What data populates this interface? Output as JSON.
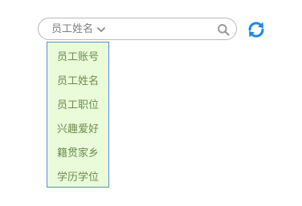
{
  "search": {
    "field_label": "员工姓名",
    "input_value": "",
    "placeholder": "",
    "icon": "search-icon"
  },
  "refresh": {
    "icon": "refresh-icon",
    "color": "#1e88e5"
  },
  "dropdown": {
    "items": [
      "员工账号",
      "员工姓名",
      "员工职位",
      "兴趣爱好",
      "籍贯家乡",
      "学历学位"
    ],
    "background": "#e9fbd9",
    "border_color": "#5b8bd6",
    "text_color": "#6e8c4f"
  }
}
